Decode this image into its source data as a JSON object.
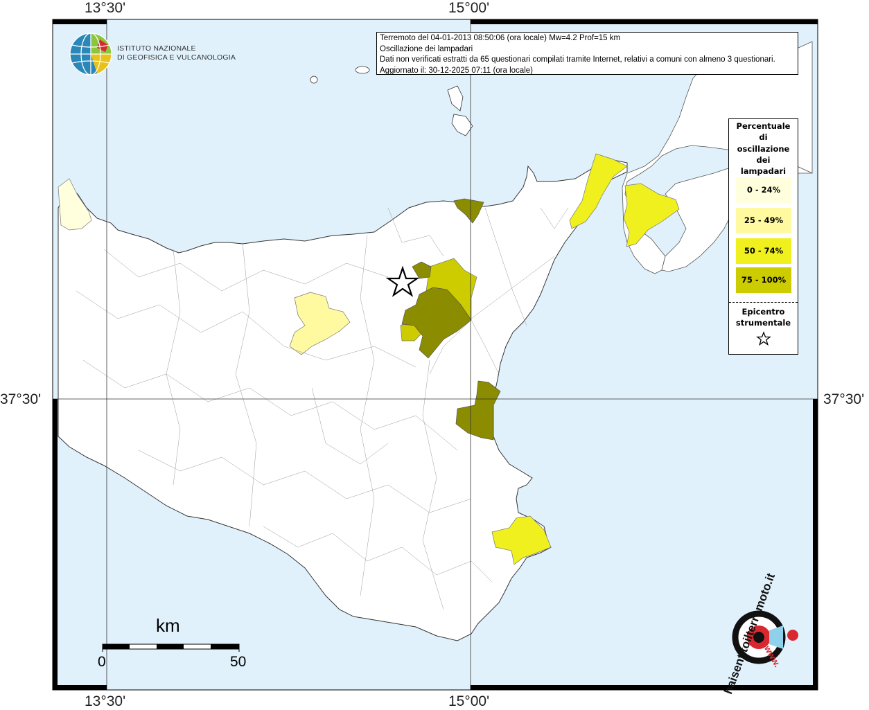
{
  "map": {
    "coords": {
      "lon_left_top": "13°30'",
      "lon_right_top": "15°00'",
      "lon_left_bottom": "13°30'",
      "lon_right_bottom": "15°00'",
      "lat_left": "37°30'",
      "lat_right": "37°30'"
    },
    "colors": {
      "sea": "#e0f1fb",
      "land": "#ffffff",
      "class_0_24": "#ffffdd",
      "class_25_49": "#fffaa0",
      "class_50_74": "#f0f01e",
      "class_75_100": "#8c8c00",
      "class_50_74_dark": "#cccc00"
    }
  },
  "ingv": {
    "line1": "ISTITUTO NAZIONALE",
    "line2": "DI GEOFISICA E VULCANOLOGIA"
  },
  "info": {
    "line1": "Terremoto del 04-01-2013 08:50:06 (ora locale) Mw=4.2 Prof=15 km",
    "line2": "Oscillazione dei lampadari",
    "line3": "Dati non verificati estratti da 65 questionari compilati tramite Internet, relativi a comuni con almeno 3 questionari.",
    "line4": "Aggiornato il: 30-12-2025 07:11 (ora locale)"
  },
  "legend": {
    "title_lines": [
      "Percentuale",
      "di",
      "oscillazione",
      "dei",
      "lampadari"
    ],
    "items": [
      {
        "label": "0 - 24%",
        "color": "#ffffdd"
      },
      {
        "label": "25 - 49%",
        "color": "#fffaa0"
      },
      {
        "label": "50 - 74%",
        "color": "#f0f01e"
      },
      {
        "label": "75 - 100%",
        "color": "#cccc00"
      }
    ],
    "epicenter_lines": [
      "Epicentro",
      "strumentale"
    ]
  },
  "scale": {
    "unit": "km",
    "min": "0",
    "max": "50"
  },
  "hsi_logo": {
    "text": "haisentitoilterremoto.it",
    "prefix": "www."
  }
}
